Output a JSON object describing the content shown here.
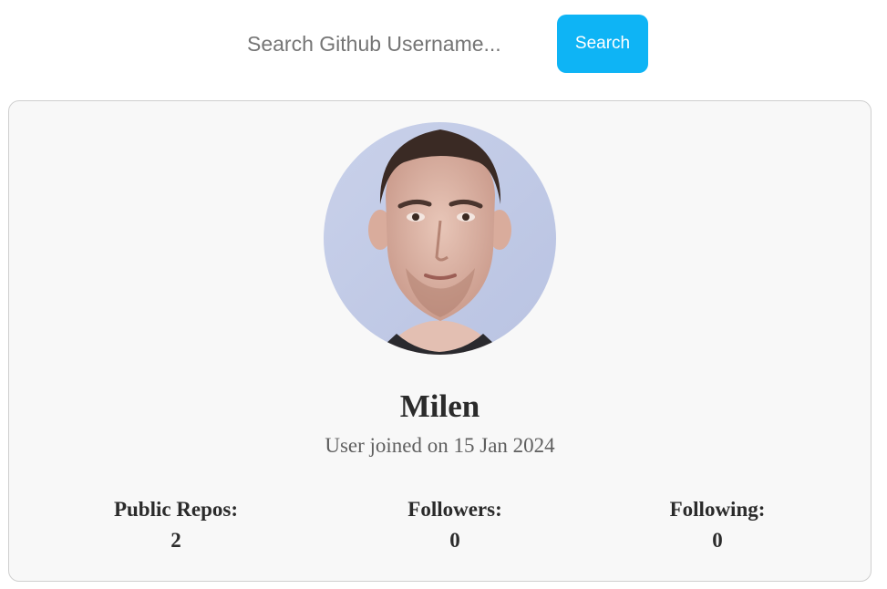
{
  "search": {
    "placeholder": "Search Github Username...",
    "value": "",
    "button_label": "Search"
  },
  "profile": {
    "name": "Milen",
    "joined": "User joined on 15 Jan 2024",
    "stats": {
      "repos": {
        "label": "Public Repos:",
        "value": "2"
      },
      "followers": {
        "label": "Followers:",
        "value": "0"
      },
      "following": {
        "label": "Following:",
        "value": "0"
      }
    }
  },
  "colors": {
    "accent": "#0eb4f5",
    "card_background": "#f8f8f8",
    "card_border": "#cfcfcf",
    "text": "#2b2b2b",
    "muted_text": "#5f5f5f"
  }
}
